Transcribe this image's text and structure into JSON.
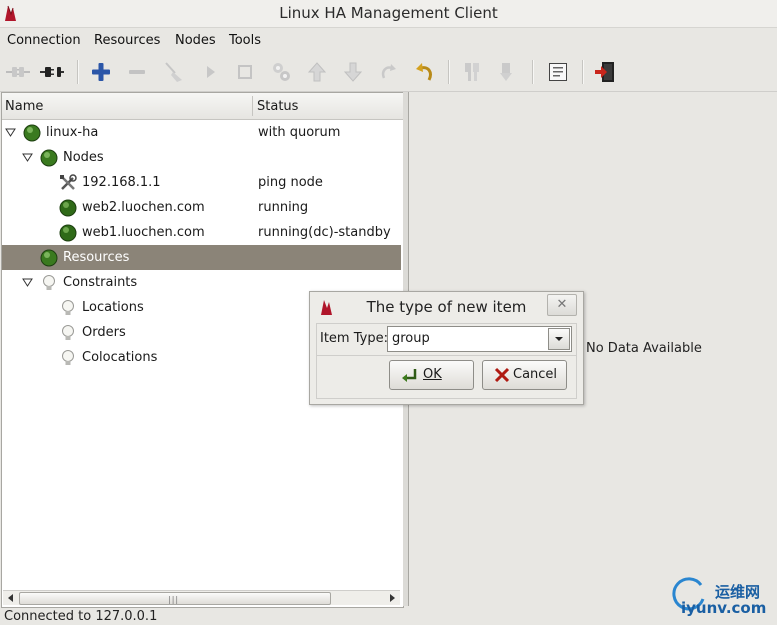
{
  "window": {
    "title": "Linux HA Management Client",
    "app_icon": "heartbeat-logo-icon"
  },
  "menubar": {
    "items": [
      "Connection",
      "Resources",
      "Nodes",
      "Tools"
    ]
  },
  "toolbar": {
    "buttons": [
      {
        "icon": "connect-plug-icon",
        "enabled": false
      },
      {
        "icon": "disconnect-plug-icon",
        "enabled": true
      },
      {
        "icon": "add-plus-icon",
        "enabled": true
      },
      {
        "icon": "remove-minus-icon",
        "enabled": false
      },
      {
        "icon": "cleanup-broom-icon",
        "enabled": false
      },
      {
        "icon": "start-play-icon",
        "enabled": false
      },
      {
        "icon": "stop-square-icon",
        "enabled": false
      },
      {
        "icon": "gears-icon",
        "enabled": false
      },
      {
        "icon": "move-up-arrow-icon",
        "enabled": false
      },
      {
        "icon": "move-down-arrow-icon",
        "enabled": false
      },
      {
        "icon": "redo-arrow-icon",
        "enabled": false
      },
      {
        "icon": "undo-arrow-icon",
        "enabled": true
      },
      {
        "icon": "standby-node-icon",
        "enabled": false
      },
      {
        "icon": "active-node-icon",
        "enabled": false
      },
      {
        "icon": "view-document-icon",
        "enabled": true
      },
      {
        "icon": "exit-door-icon",
        "enabled": true
      }
    ]
  },
  "tree": {
    "columns": {
      "name": "Name",
      "status": "Status"
    },
    "rows": [
      {
        "label": "linux-ha",
        "status": "with quorum",
        "icon": "green-ball-icon",
        "expander": "open"
      },
      {
        "label": "Nodes",
        "status": "",
        "icon": "green-ball-icon",
        "expander": "open"
      },
      {
        "label": "192.168.1.1",
        "status": "ping node",
        "icon": "tools-icon",
        "expander": "none"
      },
      {
        "label": "web2.luochen.com",
        "status": "running",
        "icon": "green-ball-icon",
        "expander": "none"
      },
      {
        "label": "web1.luochen.com",
        "status": "running(dc)-standby",
        "icon": "green-ball-icon",
        "expander": "none"
      },
      {
        "label": "Resources",
        "status": "",
        "icon": "green-ball-icon",
        "expander": "none",
        "selected": true
      },
      {
        "label": "Constraints",
        "status": "",
        "icon": "lightbulb-icon",
        "expander": "open"
      },
      {
        "label": "Locations",
        "status": "",
        "icon": "lightbulb-icon",
        "expander": "none"
      },
      {
        "label": "Orders",
        "status": "",
        "icon": "lightbulb-icon",
        "expander": "none"
      },
      {
        "label": "Colocations",
        "status": "",
        "icon": "lightbulb-icon",
        "expander": "none"
      }
    ]
  },
  "right_pane": {
    "empty_text": "No Data Available"
  },
  "statusbar": {
    "text": "Connected to 127.0.0.1"
  },
  "dialog": {
    "title": "The type of new item",
    "close_label": "✕",
    "field_label": "Item Type:",
    "selected_value": "group",
    "ok_label": "OK",
    "cancel_label": "Cancel"
  },
  "watermark": {
    "cn": "运维网",
    "en": "iyunv.com"
  }
}
